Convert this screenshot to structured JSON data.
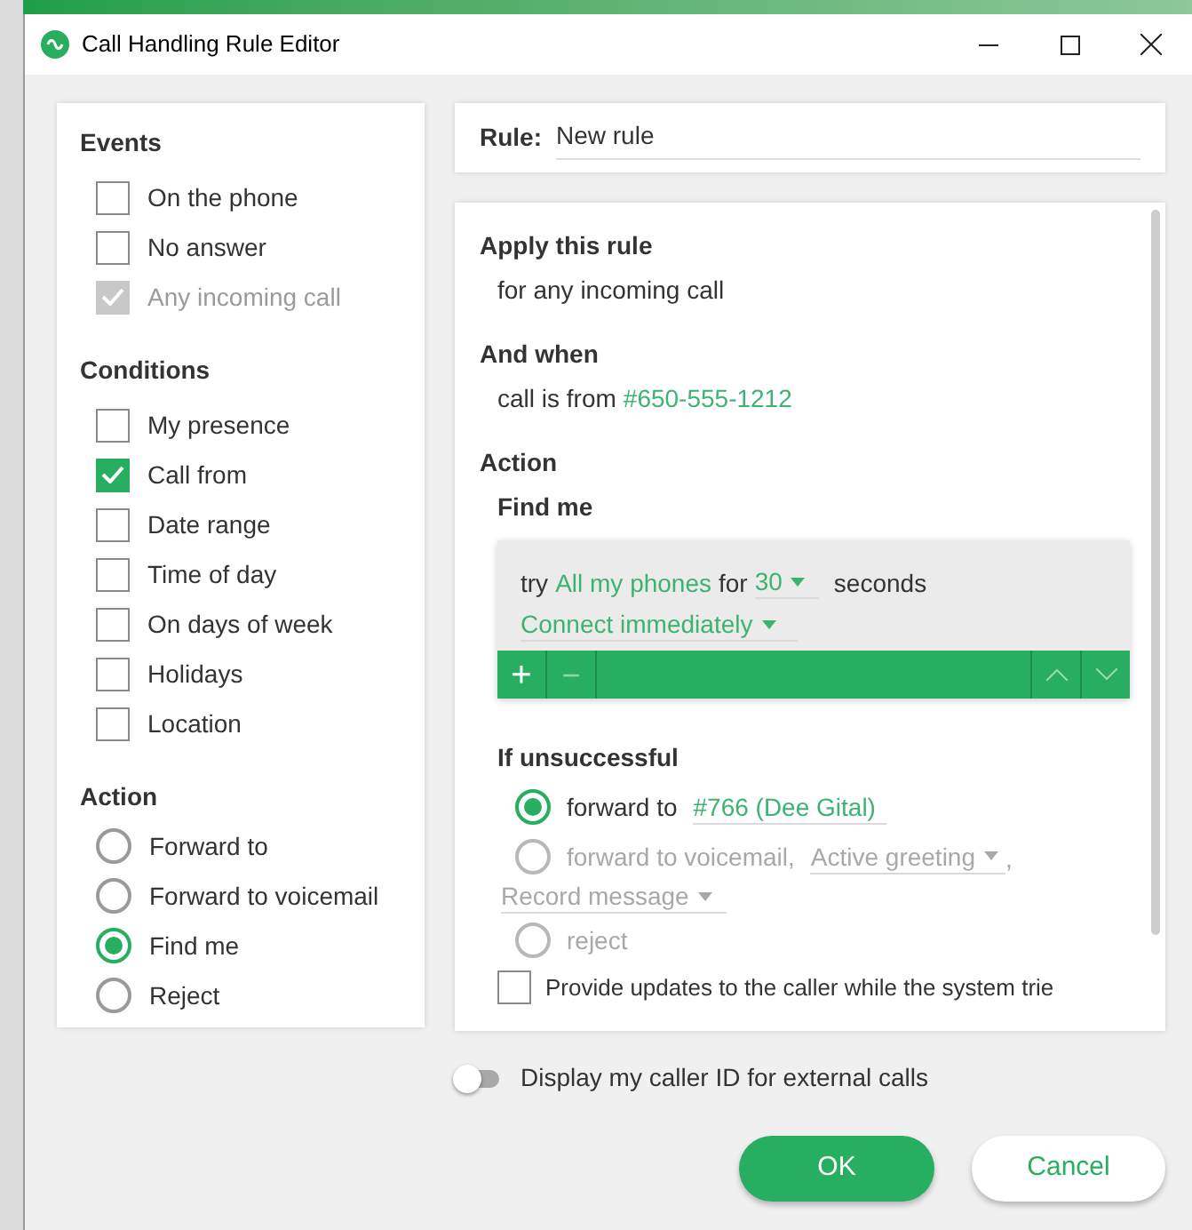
{
  "window": {
    "title": "Call Handling Rule Editor"
  },
  "events": {
    "title": "Events",
    "items": [
      {
        "label": "On the phone",
        "checked": false,
        "disabled": false
      },
      {
        "label": "No answer",
        "checked": false,
        "disabled": false
      },
      {
        "label": "Any incoming call",
        "checked": true,
        "disabled": true
      }
    ]
  },
  "conditions": {
    "title": "Conditions",
    "items": [
      {
        "label": "My presence",
        "checked": false
      },
      {
        "label": "Call from",
        "checked": true
      },
      {
        "label": "Date range",
        "checked": false
      },
      {
        "label": "Time of day",
        "checked": false
      },
      {
        "label": "On days of week",
        "checked": false
      },
      {
        "label": "Holidays",
        "checked": false
      },
      {
        "label": "Location",
        "checked": false
      }
    ]
  },
  "actions": {
    "title": "Action",
    "items": [
      {
        "label": "Forward to",
        "selected": false
      },
      {
        "label": "Forward to voicemail",
        "selected": false
      },
      {
        "label": "Find me",
        "selected": true
      },
      {
        "label": "Reject",
        "selected": false
      }
    ]
  },
  "rule": {
    "label": "Rule:",
    "value": "New rule"
  },
  "summary": {
    "apply_title": "Apply this rule",
    "apply_text": "for any incoming call",
    "when_title": "And when",
    "when_text": "call is from",
    "when_link": "#650-555-1212",
    "action_title": "Action",
    "action_subtitle": "Find me"
  },
  "find_me": {
    "try": "try",
    "phones": "All my phones",
    "for": "for",
    "seconds_value": "30",
    "seconds": "seconds",
    "connect": "Connect immediately",
    "toolbar": [
      "+",
      "−"
    ]
  },
  "unsuccessful": {
    "title": "If unsuccessful",
    "options": [
      {
        "kind": "forward",
        "label": "forward to",
        "value": "#766 (Dee Gital)",
        "selected": true
      },
      {
        "kind": "voicemail",
        "label": "forward to voicemail,",
        "value": "Active greeting",
        "comma": ",",
        "second_value": "Record message",
        "selected": false
      },
      {
        "kind": "reject",
        "label": "reject",
        "selected": false
      }
    ]
  },
  "provide_updates": {
    "label": "Provide updates to the caller while the system trie",
    "checked": false
  },
  "caller_id": {
    "label": "Display my caller ID for external calls",
    "on": false
  },
  "buttons": {
    "ok": "OK",
    "cancel": "Cancel"
  }
}
